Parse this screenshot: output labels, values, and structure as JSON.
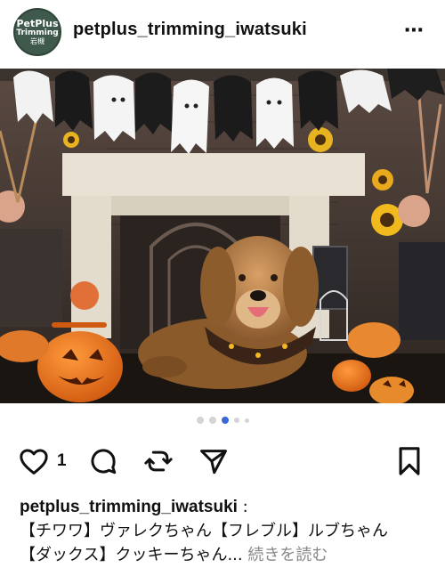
{
  "post": {
    "username": "petplus_trimming_iwatsuki",
    "avatar_text": [
      "PetPlus",
      "Trimming",
      "岩槻"
    ],
    "more_icon": "⋯",
    "like_count": "1",
    "carousel": {
      "total": 5,
      "active_index": 2
    },
    "caption": {
      "username": "petplus_trimming_iwatsuki",
      "separator": " :",
      "line1": "【チワワ】ヴァレクちゃん【フレブル】ルブちゃん",
      "line2": "【ダックス】クッキーちゃん...",
      "more_label": " 続きを読む"
    },
    "icons": {
      "like": "heart-icon",
      "comment": "comment-icon",
      "repost": "repost-icon",
      "share": "paper-plane-icon",
      "save": "bookmark-icon"
    },
    "colors": {
      "active_dot": "#3a67d8",
      "inactive_dot": "#d4d4d4",
      "avatar_bg": "#3f5a4c"
    }
  }
}
